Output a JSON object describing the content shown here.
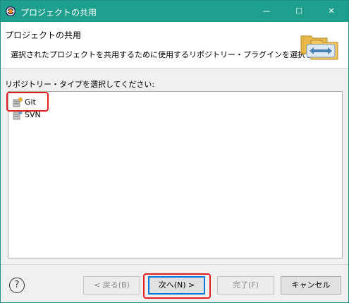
{
  "window": {
    "title": "プロジェクトの共用",
    "controls": {
      "minimize": "—",
      "maximize": "☐",
      "close": "✕"
    }
  },
  "header": {
    "title": "プロジェクトの共用",
    "description": "選択されたプロジェクトを共用するために使用するリポジトリー・プラグインを選択します。",
    "icon": "shared-folders-icon"
  },
  "repository_list": {
    "label": "リポジトリー・タイプを選択してください:",
    "items": [
      {
        "label": "Git",
        "icon": "git-repository-icon",
        "highlighted": true
      },
      {
        "label": "SVN",
        "icon": "svn-repository-icon",
        "highlighted": false
      }
    ]
  },
  "footer": {
    "help": "?",
    "back": "< 戻る(B)",
    "next": "次へ(N) >",
    "finish": "完了(F)",
    "cancel": "キャンセル"
  },
  "colors": {
    "titlebar": "#1fa08f",
    "highlight": "#e02020",
    "default_button_border": "#0078d7"
  }
}
